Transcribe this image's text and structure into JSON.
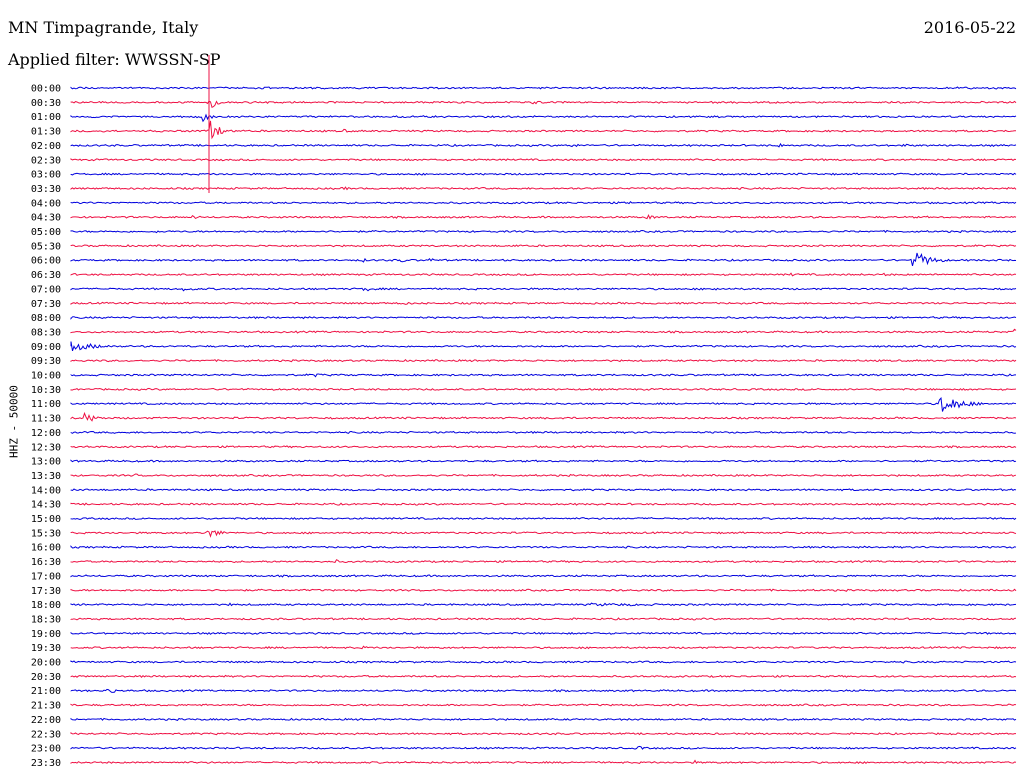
{
  "header": {
    "station": "MN Timpagrande, Italy",
    "date": "2016-05-22",
    "filter": "Applied filter: WWSSN-SP"
  },
  "colors": {
    "even_trace": "#0000dd",
    "odd_trace": "#ee1144",
    "text": "#000000"
  },
  "chart_data": {
    "type": "line",
    "title": "MN Timpagrande, Italy",
    "ylabel": "HHZ - 50000",
    "xlabel": "",
    "series_colors": [
      "#0000dd",
      "#ee1144"
    ],
    "traces": [
      {
        "label": "00:00",
        "events": []
      },
      {
        "label": "00:30",
        "events": [
          {
            "t": 0.145,
            "amp": 10,
            "dur": 0.02
          },
          {
            "t": 0.49,
            "amp": 2.5,
            "dur": 0.03
          }
        ]
      },
      {
        "label": "01:00",
        "events": [
          {
            "t": 0.14,
            "amp": 9,
            "dur": 0.015
          }
        ]
      },
      {
        "label": "01:30",
        "events": [
          {
            "t": 0.145,
            "amp": 14,
            "dur": 0.03
          },
          {
            "t": 0.29,
            "amp": 2,
            "dur": 0.01
          },
          {
            "t": 0.96,
            "amp": 2,
            "dur": 0.01
          }
        ]
      },
      {
        "label": "02:00",
        "events": [
          {
            "t": 0.53,
            "amp": 2.5,
            "dur": 0.02
          },
          {
            "t": 0.75,
            "amp": 2,
            "dur": 0.02
          },
          {
            "t": 0.88,
            "amp": 2,
            "dur": 0.02
          }
        ]
      },
      {
        "label": "02:30",
        "events": []
      },
      {
        "label": "03:00",
        "events": []
      },
      {
        "label": "03:30",
        "events": [
          {
            "t": 0.29,
            "amp": 2,
            "dur": 0.01
          }
        ]
      },
      {
        "label": "04:00",
        "events": [
          {
            "t": 0.59,
            "amp": 2,
            "dur": 0.01
          }
        ]
      },
      {
        "label": "04:30",
        "events": [
          {
            "t": 0.13,
            "amp": 2.5,
            "dur": 0.01
          },
          {
            "t": 0.61,
            "amp": 2.5,
            "dur": 0.03
          }
        ]
      },
      {
        "label": "05:00",
        "events": [
          {
            "t": 0.09,
            "amp": 1.5,
            "dur": 0.02
          }
        ]
      },
      {
        "label": "05:30",
        "events": [
          {
            "t": 0.47,
            "amp": 2,
            "dur": 0.02
          }
        ]
      },
      {
        "label": "06:00",
        "events": [
          {
            "t": 0.31,
            "amp": 2,
            "dur": 0.01
          },
          {
            "t": 0.35,
            "amp": 2,
            "dur": 0.02
          },
          {
            "t": 0.38,
            "amp": 2,
            "dur": 0.02
          },
          {
            "t": 0.89,
            "amp": 10,
            "dur": 0.05
          }
        ]
      },
      {
        "label": "06:30",
        "events": [
          {
            "t": 0.76,
            "amp": 2,
            "dur": 0.02
          },
          {
            "t": 0.86,
            "amp": 2,
            "dur": 0.02
          }
        ]
      },
      {
        "label": "07:00",
        "events": [
          {
            "t": 0.12,
            "amp": 2,
            "dur": 0.05
          },
          {
            "t": 0.31,
            "amp": 2.5,
            "dur": 0.04
          },
          {
            "t": 0.68,
            "amp": 2,
            "dur": 0.03
          }
        ]
      },
      {
        "label": "07:30",
        "events": [
          {
            "t": 0.35,
            "amp": 2,
            "dur": 0.03
          }
        ]
      },
      {
        "label": "08:00",
        "events": []
      },
      {
        "label": "08:30",
        "events": [
          {
            "t": 0.998,
            "amp": 5,
            "dur": 0.003
          }
        ]
      },
      {
        "label": "09:00",
        "events": [
          {
            "t": 0.0,
            "amp": 5,
            "dur": 0.08
          }
        ]
      },
      {
        "label": "09:30",
        "events": []
      },
      {
        "label": "10:00",
        "events": [
          {
            "t": 0.06,
            "amp": 1.5,
            "dur": 0.02
          },
          {
            "t": 0.26,
            "amp": 2,
            "dur": 0.02
          }
        ]
      },
      {
        "label": "10:30",
        "events": [
          {
            "t": 0.79,
            "amp": 1.5,
            "dur": 0.02
          }
        ]
      },
      {
        "label": "11:00",
        "events": [
          {
            "t": 0.92,
            "amp": 10,
            "dur": 0.06
          }
        ]
      },
      {
        "label": "11:30",
        "events": [
          {
            "t": 0.015,
            "amp": 5,
            "dur": 0.04
          },
          {
            "t": 0.52,
            "amp": 1.5,
            "dur": 0.02
          }
        ]
      },
      {
        "label": "12:00",
        "events": []
      },
      {
        "label": "12:30",
        "events": []
      },
      {
        "label": "13:00",
        "events": []
      },
      {
        "label": "13:30",
        "events": [
          {
            "t": 0.07,
            "amp": 1.5,
            "dur": 0.01
          }
        ]
      },
      {
        "label": "14:00",
        "events": []
      },
      {
        "label": "14:30",
        "events": []
      },
      {
        "label": "15:00",
        "events": []
      },
      {
        "label": "15:30",
        "events": [
          {
            "t": 0.145,
            "amp": 5,
            "dur": 0.04
          },
          {
            "t": 0.26,
            "amp": 1.5,
            "dur": 0.02
          }
        ]
      },
      {
        "label": "16:00",
        "events": []
      },
      {
        "label": "16:30",
        "events": [
          {
            "t": 0.28,
            "amp": 2,
            "dur": 0.02
          }
        ]
      },
      {
        "label": "17:00",
        "events": []
      },
      {
        "label": "17:30",
        "events": []
      },
      {
        "label": "18:00",
        "events": [
          {
            "t": 0.07,
            "amp": 1.5,
            "dur": 0.01
          },
          {
            "t": 0.17,
            "amp": 1.5,
            "dur": 0.03
          },
          {
            "t": 0.55,
            "amp": 1.5,
            "dur": 0.45
          }
        ]
      },
      {
        "label": "18:30",
        "events": []
      },
      {
        "label": "19:00",
        "events": []
      },
      {
        "label": "19:30",
        "events": [
          {
            "t": 0.31,
            "amp": 2,
            "dur": 0.02
          }
        ]
      },
      {
        "label": "20:00",
        "events": []
      },
      {
        "label": "20:30",
        "events": []
      },
      {
        "label": "21:00",
        "events": [
          {
            "t": 0.04,
            "amp": 5,
            "dur": 0.015
          }
        ]
      },
      {
        "label": "21:30",
        "events": []
      },
      {
        "label": "22:00",
        "events": []
      },
      {
        "label": "22:30",
        "events": []
      },
      {
        "label": "23:00",
        "events": [
          {
            "t": 0.6,
            "amp": 2,
            "dur": 0.03
          }
        ]
      },
      {
        "label": "23:30",
        "events": [
          {
            "t": 0.66,
            "amp": 2,
            "dur": 0.01
          }
        ]
      }
    ]
  }
}
